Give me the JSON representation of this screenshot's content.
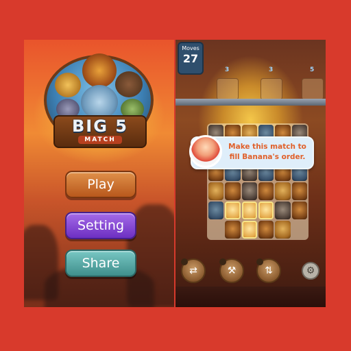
{
  "menu": {
    "logo_title": "BIG 5",
    "logo_subtitle": "MATCH",
    "buttons": {
      "play": "Play",
      "setting": "Setting",
      "share": "Share"
    }
  },
  "game": {
    "moves_label": "Moves",
    "moves_value": "27",
    "order_counts": [
      "3",
      "3",
      "5"
    ],
    "hint_text": "Make this match to fill Banana's order."
  },
  "colors": {
    "background": "#d83a2c",
    "play_button": "#c86a2c",
    "setting_button": "#8a47d6",
    "share_button": "#5aa9a6",
    "hint_text": "#e0602a",
    "moves_box": "#2f4f6d"
  },
  "icons": {
    "boosters": [
      "shuffle-icon",
      "hammer-icon",
      "swap-icon"
    ],
    "settings": "gear-icon"
  }
}
